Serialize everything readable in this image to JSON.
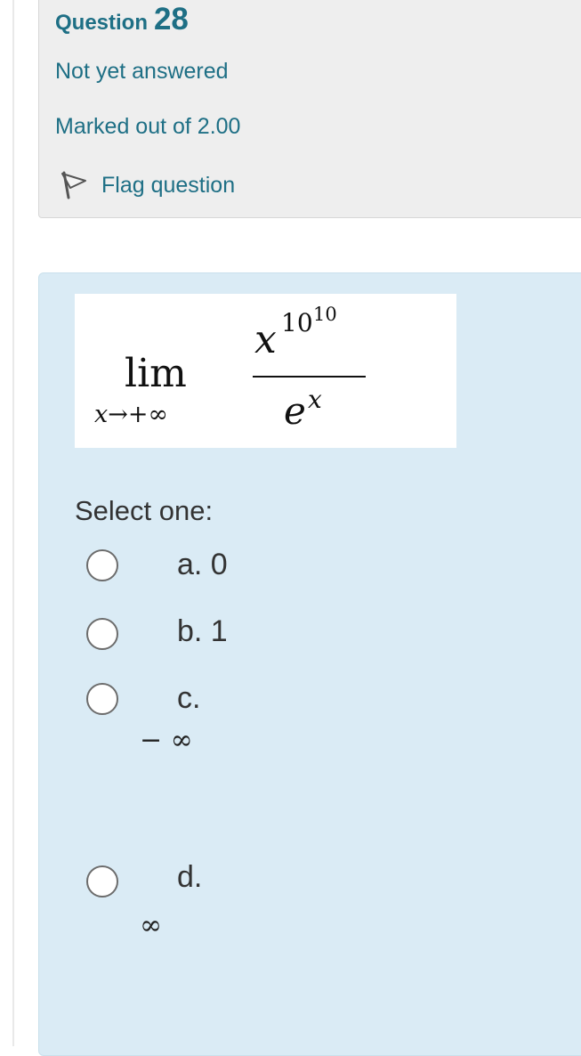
{
  "question": {
    "label": "Question",
    "number": "28",
    "status": "Not yet answered",
    "marks": "Marked out of 2.00",
    "flag_label": "Flag question"
  },
  "formula": {
    "lim": "lim",
    "subscript": "x→+∞",
    "numerator_base": "x",
    "numerator_exp": "10",
    "numerator_exp_exp": "10",
    "denominator_base": "e",
    "denominator_exp": "x"
  },
  "prompt": "Select one:",
  "options": [
    {
      "label": "a. 0",
      "math": ""
    },
    {
      "label": "b. 1",
      "math": ""
    },
    {
      "label": "c.",
      "math": "− ∞"
    },
    {
      "label": "d.",
      "math": "∞"
    }
  ],
  "colors": {
    "link_teal": "#1e6f85",
    "info_bg": "#eeeeee",
    "content_bg": "#daebf5"
  },
  "icons": {
    "flag": "flag-icon"
  }
}
